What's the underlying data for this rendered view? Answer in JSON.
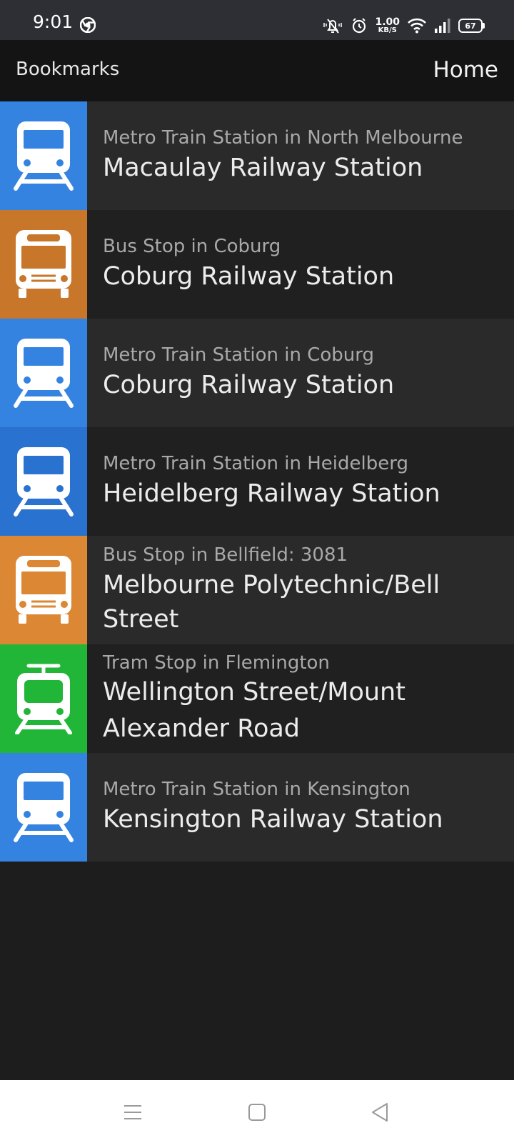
{
  "status_bar": {
    "time": "9:01",
    "speed_value": "1.00",
    "speed_unit": "KB/S",
    "battery": "67"
  },
  "app_bar": {
    "title": "Bookmarks",
    "home_label": "Home"
  },
  "bookmarks": [
    {
      "type": "train",
      "subtitle": "Metro Train Station in North Melbourne",
      "name": "Macaulay Railway Station",
      "color": "#3583e0"
    },
    {
      "type": "bus",
      "subtitle": "Bus Stop in Coburg",
      "name": "Coburg Railway Station",
      "color": "#c7762a"
    },
    {
      "type": "train",
      "subtitle": "Metro Train Station in Coburg",
      "name": "Coburg Railway Station",
      "color": "#3583e0"
    },
    {
      "type": "train",
      "subtitle": "Metro Train Station in Heidelberg",
      "name": "Heidelberg Railway Station",
      "color": "#2a72cf"
    },
    {
      "type": "bus",
      "subtitle": "Bus Stop in Bellfield: 3081",
      "name": "Melbourne Polytechnic/Bell Street",
      "color": "#db8733"
    },
    {
      "type": "tram",
      "subtitle": "Tram Stop in Flemington",
      "name": "Wellington Street/Mount Alexander Road",
      "color": "#22b638"
    },
    {
      "type": "train",
      "subtitle": "Metro Train Station in Kensington",
      "name": "Kensington Railway Station",
      "color": "#3583e0"
    }
  ],
  "icons": {
    "train": "train-icon",
    "bus": "bus-icon",
    "tram": "tram-icon"
  }
}
